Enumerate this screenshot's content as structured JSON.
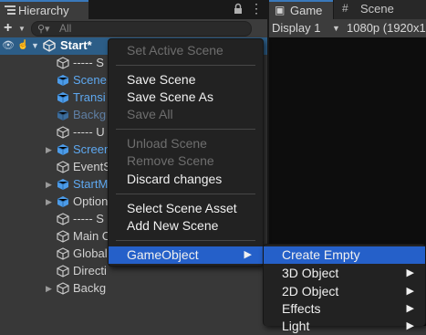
{
  "hierarchy": {
    "tab_label": "Hierarchy",
    "search_placeholder": "All",
    "rows": [
      {
        "label": "Start*",
        "style": "root"
      },
      {
        "label": "----- S",
        "style": "gray"
      },
      {
        "label": "Scene",
        "style": "blue"
      },
      {
        "label": "Transi",
        "style": "blue"
      },
      {
        "label": "Backg",
        "style": "dim"
      },
      {
        "label": "----- U",
        "style": "gray"
      },
      {
        "label": "Screen",
        "style": "blue"
      },
      {
        "label": "EventS",
        "style": "gray"
      },
      {
        "label": "StartM",
        "style": "blue"
      },
      {
        "label": "Option",
        "style": "gray"
      },
      {
        "label": "----- S",
        "style": "gray"
      },
      {
        "label": "Main C",
        "style": "gray"
      },
      {
        "label": "Global",
        "style": "gray"
      },
      {
        "label": "Directi",
        "style": "gray"
      },
      {
        "label": "Backg",
        "style": "gray"
      }
    ]
  },
  "game_panel": {
    "tab_game": "Game",
    "tab_scene": "Scene",
    "display": "Display 1",
    "resolution": "1080p (1920x1"
  },
  "context_menu": {
    "set_active_scene": "Set Active Scene",
    "save_scene": "Save Scene",
    "save_scene_as": "Save Scene As",
    "save_all": "Save All",
    "unload_scene": "Unload Scene",
    "remove_scene": "Remove Scene",
    "discard_changes": "Discard changes",
    "select_scene_asset": "Select Scene Asset",
    "add_new_scene": "Add New Scene",
    "gameobject": "GameObject"
  },
  "submenu": {
    "create_empty": "Create Empty",
    "object_3d": "3D Object",
    "object_2d": "2D Object",
    "effects": "Effects",
    "light": "Light"
  },
  "colors": {
    "accent": "#2560c9",
    "selection": "#2c5d87",
    "prefab_blue": "#5ea8f0"
  }
}
